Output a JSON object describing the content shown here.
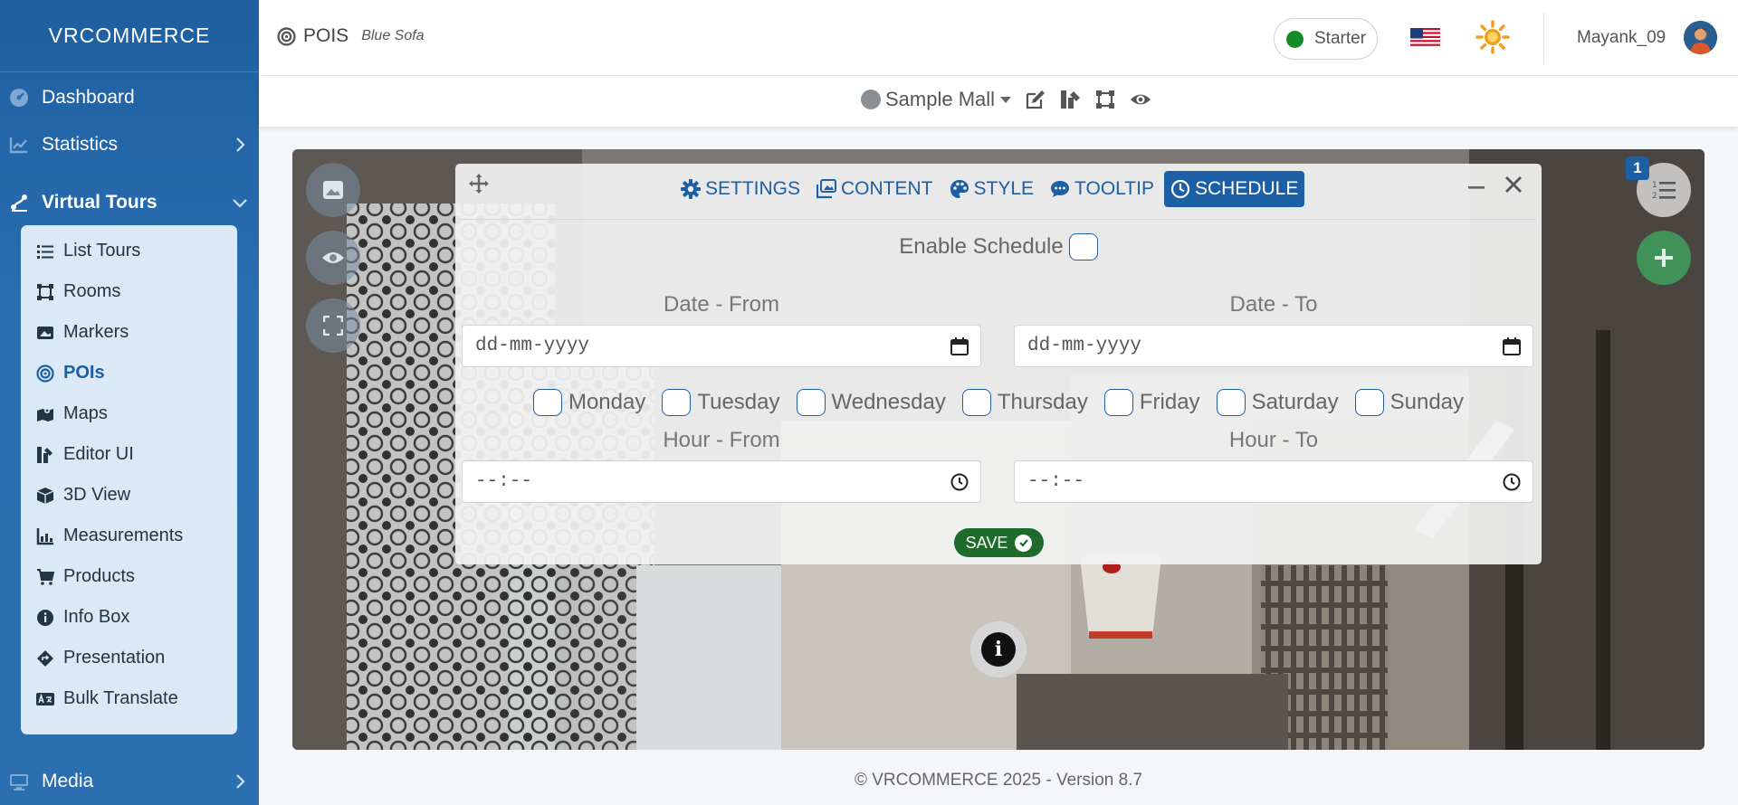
{
  "sidebar": {
    "brand": "VRCOMMERCE",
    "items": [
      {
        "label": "Dashboard",
        "icon": "dashboard-icon"
      },
      {
        "label": "Statistics",
        "icon": "chart-icon"
      },
      {
        "label": "Virtual Tours",
        "icon": "virtual-tours-icon"
      },
      {
        "label": "Media",
        "icon": "monitor-icon"
      }
    ],
    "submenu": [
      {
        "label": "List Tours",
        "icon": "list-icon"
      },
      {
        "label": "Rooms",
        "icon": "rooms-icon"
      },
      {
        "label": "Markers",
        "icon": "markers-icon"
      },
      {
        "label": "POIs",
        "icon": "target-icon"
      },
      {
        "label": "Maps",
        "icon": "map-icon"
      },
      {
        "label": "Editor UI",
        "icon": "editor-ui-icon"
      },
      {
        "label": "3D View",
        "icon": "cube-icon"
      },
      {
        "label": "Measurements",
        "icon": "ruler-icon"
      },
      {
        "label": "Products",
        "icon": "cart-icon"
      },
      {
        "label": "Info Box",
        "icon": "info-icon"
      },
      {
        "label": "Presentation",
        "icon": "presentation-icon"
      },
      {
        "label": "Bulk Translate",
        "icon": "translate-icon"
      }
    ]
  },
  "header": {
    "title": "POIS",
    "subtitle": "Blue Sofa",
    "plan": "Starter",
    "plan_color": "#148c2a",
    "username": "Mayank_09"
  },
  "toolbar": {
    "tour_name": "Sample Mall"
  },
  "viewer": {
    "list_badge": "1"
  },
  "panel": {
    "tabs": [
      {
        "label": "SETTINGS",
        "icon": "gear-icon"
      },
      {
        "label": "CONTENT",
        "icon": "images-icon"
      },
      {
        "label": "STYLE",
        "icon": "palette-icon"
      },
      {
        "label": "TOOLTIP",
        "icon": "comment-icon"
      },
      {
        "label": "SCHEDULE",
        "icon": "clock-icon",
        "active": true
      }
    ],
    "enable_schedule_label": "Enable Schedule",
    "date_from_label": "Date - From",
    "date_to_label": "Date - To",
    "date_from_placeholder": "dd-mm-yyyy",
    "date_to_placeholder": "dd-mm-yyyy",
    "days": [
      "Monday",
      "Tuesday",
      "Wednesday",
      "Thursday",
      "Friday",
      "Saturday",
      "Sunday"
    ],
    "hour_from_label": "Hour - From",
    "hour_to_label": "Hour - To",
    "hour_from_placeholder": "--:--",
    "hour_to_placeholder": "--:--",
    "save_label": "SAVE"
  },
  "footer": {
    "text": "© VRCOMMERCE 2025 - Version 8.7"
  },
  "colors": {
    "primary": "#1d5fa5",
    "sidebar": "#2a6fb2",
    "save": "#1e6b2b",
    "add_button": "#3f9a5c"
  }
}
